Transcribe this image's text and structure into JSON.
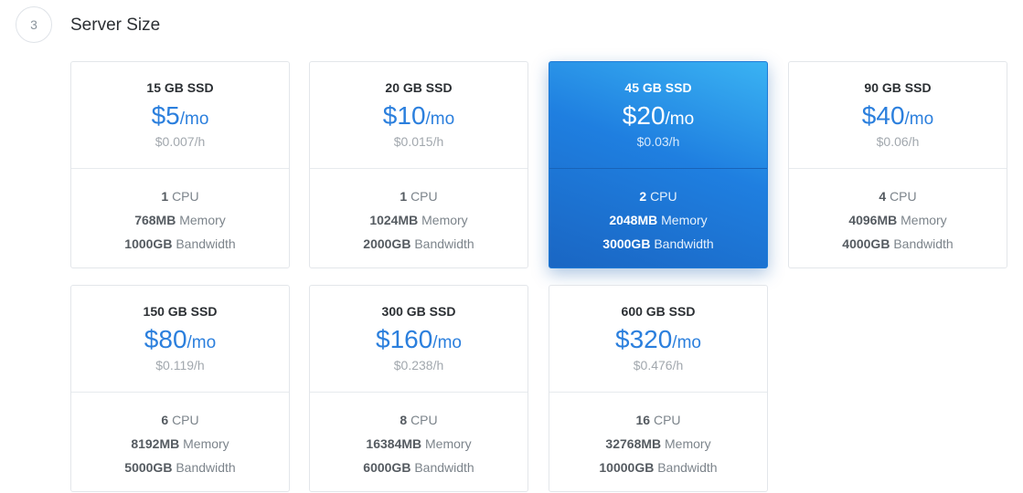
{
  "section": {
    "step_number": "3",
    "title": "Server Size"
  },
  "plans": [
    {
      "disk": "15 GB SSD",
      "price": "$5",
      "per": "/mo",
      "hourly": "$0.007/h",
      "cpu_value": "1",
      "cpu_label": "CPU",
      "memory_value": "768MB",
      "memory_label": "Memory",
      "bandwidth_value": "1000GB",
      "bandwidth_label": "Bandwidth",
      "selected": false
    },
    {
      "disk": "20 GB SSD",
      "price": "$10",
      "per": "/mo",
      "hourly": "$0.015/h",
      "cpu_value": "1",
      "cpu_label": "CPU",
      "memory_value": "1024MB",
      "memory_label": "Memory",
      "bandwidth_value": "2000GB",
      "bandwidth_label": "Bandwidth",
      "selected": false
    },
    {
      "disk": "45 GB SSD",
      "price": "$20",
      "per": "/mo",
      "hourly": "$0.03/h",
      "cpu_value": "2",
      "cpu_label": "CPU",
      "memory_value": "2048MB",
      "memory_label": "Memory",
      "bandwidth_value": "3000GB",
      "bandwidth_label": "Bandwidth",
      "selected": true
    },
    {
      "disk": "90 GB SSD",
      "price": "$40",
      "per": "/mo",
      "hourly": "$0.06/h",
      "cpu_value": "4",
      "cpu_label": "CPU",
      "memory_value": "4096MB",
      "memory_label": "Memory",
      "bandwidth_value": "4000GB",
      "bandwidth_label": "Bandwidth",
      "selected": false
    },
    {
      "disk": "150 GB SSD",
      "price": "$80",
      "per": "/mo",
      "hourly": "$0.119/h",
      "cpu_value": "6",
      "cpu_label": "CPU",
      "memory_value": "8192MB",
      "memory_label": "Memory",
      "bandwidth_value": "5000GB",
      "bandwidth_label": "Bandwidth",
      "selected": false
    },
    {
      "disk": "300 GB SSD",
      "price": "$160",
      "per": "/mo",
      "hourly": "$0.238/h",
      "cpu_value": "8",
      "cpu_label": "CPU",
      "memory_value": "16384MB",
      "memory_label": "Memory",
      "bandwidth_value": "6000GB",
      "bandwidth_label": "Bandwidth",
      "selected": false
    },
    {
      "disk": "600 GB SSD",
      "price": "$320",
      "per": "/mo",
      "hourly": "$0.476/h",
      "cpu_value": "16",
      "cpu_label": "CPU",
      "memory_value": "32768MB",
      "memory_label": "Memory",
      "bandwidth_value": "10000GB",
      "bandwidth_label": "Bandwidth",
      "selected": false
    }
  ],
  "colors": {
    "accent": "#2b7fdd",
    "selected_gradient_start": "#3ab3f3",
    "selected_gradient_end": "#1a66c3"
  }
}
